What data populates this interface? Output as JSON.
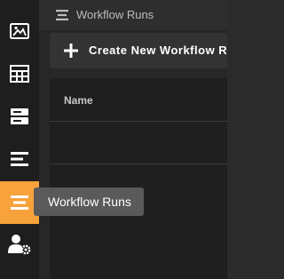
{
  "page": {
    "title": "Workflow Runs"
  },
  "toolbar": {
    "create_label": "Create New Workflow Ru"
  },
  "table": {
    "columns": [
      "Name"
    ]
  },
  "tooltip": {
    "text": "Workflow Runs"
  },
  "sidebar": {
    "items": [
      {
        "icon": "image-icon"
      },
      {
        "icon": "table-icon"
      },
      {
        "icon": "server-icon"
      },
      {
        "icon": "list-icon"
      },
      {
        "icon": "workflow-runs-icon",
        "active": true
      },
      {
        "icon": "user-settings-icon"
      }
    ]
  },
  "colors": {
    "accent": "#f7a23b",
    "sidebar_bg": "#1e1e1e",
    "tooltip_bg": "#5a5a5a"
  }
}
